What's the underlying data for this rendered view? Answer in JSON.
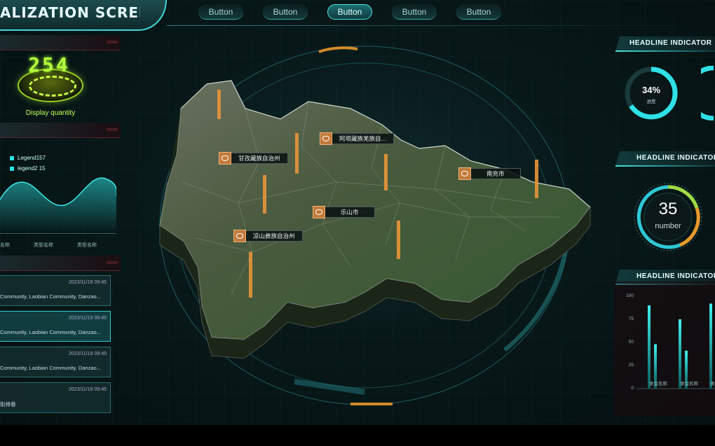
{
  "header": {
    "title": "ALIZATION SCREEN",
    "nav": [
      "Button",
      "Button",
      "Button",
      "Button",
      "Button"
    ],
    "active_index": 2
  },
  "left": {
    "display_value": "254",
    "display_label": "Display quantity",
    "legend": [
      {
        "label": "Legend157"
      },
      {
        "label": "legend2 15"
      }
    ],
    "x_labels": [
      "名称",
      "类型名称",
      "类型名称"
    ],
    "list": [
      {
        "time": "2023/11/19 09:45",
        "text": "Community, Laobian Community, Danzao...",
        "highlight": false
      },
      {
        "time": "2023/11/19 09:45",
        "text": "Community, Laobian Community, Danzao...",
        "highlight": true
      },
      {
        "time": "2023/11/19 09:45",
        "text": "Community, Laobian Community, Danzao...",
        "highlight": false
      },
      {
        "time": "2023/11/19 09:45",
        "text": "街排巷",
        "highlight": false
      }
    ]
  },
  "map": {
    "labels": [
      {
        "text": "阿坝藏族羌族自..."
      },
      {
        "text": "甘孜藏族自治州"
      },
      {
        "text": "南充市"
      },
      {
        "text": "乐山市"
      },
      {
        "text": "凉山彝族自治州"
      }
    ]
  },
  "right": {
    "headline1": "HEADLINE INDICATOR",
    "headline2": "HEADLINE INDICATOR",
    "headline3": "HEADLINE INDICATOR",
    "gauge1": {
      "value": "34%",
      "label": "进度",
      "fraction": 0.34
    },
    "gauge2": {
      "value": "35",
      "label": "number"
    },
    "bar_chart": {
      "y_ticks": [
        "100",
        "75",
        "50",
        "25",
        "0"
      ],
      "x_labels": [
        "类型名称",
        "类型名称",
        "类"
      ]
    }
  },
  "chart_data": {
    "type": "bar",
    "categories": [
      "类型名称",
      "类型名称",
      "类"
    ],
    "series": [
      {
        "values": [
          90,
          75,
          92
        ]
      },
      {
        "values": [
          48,
          41,
          0
        ]
      }
    ],
    "ylim": [
      0,
      100
    ]
  },
  "colors": {
    "accent": "#3fd9d6",
    "lime": "#b6ff3c",
    "orange": "#e8953a"
  }
}
